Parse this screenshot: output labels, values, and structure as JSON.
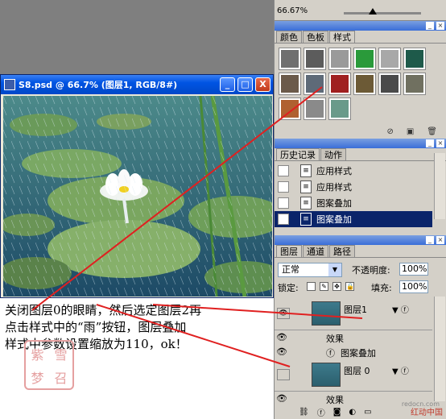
{
  "document": {
    "title": "S8.psd @ 66.7% (图层1, RGB/8#)",
    "buttons": {
      "minimize": "_",
      "maximize": "□",
      "close": "X"
    }
  },
  "caption": {
    "lines": [
      "关闭图层0的眼睛，然后选定图层2再",
      "点击样式中的“雨”按钮，图层叠加",
      "样式中参数设置缩放为110，ok！"
    ],
    "stamp": [
      "紫",
      "雪",
      "梦",
      "召"
    ]
  },
  "navigator": {
    "zoom": "66.67%"
  },
  "styles_panel": {
    "tabs": [
      "颜色",
      "色板",
      "样式"
    ],
    "active_tab": "样式",
    "swatches": [
      "#6f6f6f",
      "#5c5c5c",
      "#9a9a9a",
      "#2a9a3a",
      "#a8a8a8",
      "#1e5a4a",
      "#6b5a4a",
      "#5e6a78",
      "#a02020",
      "#6c5a36",
      "#4a4a4a",
      "#707060",
      "#b06030",
      "#8a8a8a",
      "#6a9a8a"
    ],
    "footer_icons": [
      "no-icon",
      "new-icon",
      "trash-icon"
    ]
  },
  "history_panel": {
    "tabs": [
      "历史记录",
      "动作"
    ],
    "active_tab": "历史记录",
    "items": [
      {
        "label": "应用样式",
        "selected": false
      },
      {
        "label": "应用样式",
        "selected": false
      },
      {
        "label": "图案叠加",
        "selected": false
      },
      {
        "label": "图案叠加",
        "selected": true
      }
    ]
  },
  "layers_panel": {
    "tabs": [
      "图层",
      "通道",
      "路径"
    ],
    "active_tab": "图层",
    "blend_mode": "正常",
    "opacity_label": "不透明度:",
    "opacity_value": "100%",
    "lock_label": "锁定:",
    "fill_label": "填充:",
    "fill_value": "100%",
    "layers": [
      {
        "name": "图层1",
        "effects_label": "效果",
        "effect": "图案叠加"
      },
      {
        "name": "图层 0",
        "effects_label": "效果"
      }
    ]
  },
  "watermark": {
    "site": "红动中国",
    "url": "redocn.com"
  }
}
